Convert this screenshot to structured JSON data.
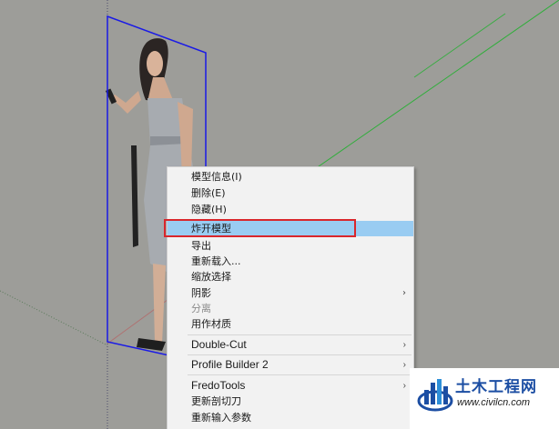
{
  "context_menu": {
    "items": [
      {
        "label": "模型信息(I)",
        "disabled": false
      },
      {
        "label": "删除(E)",
        "disabled": false
      },
      {
        "label": "隐藏(H)",
        "disabled": false
      },
      {
        "label": "炸开模型",
        "disabled": false,
        "highlighted": true
      },
      {
        "label": "导出",
        "disabled": false
      },
      {
        "label": "重新载入...",
        "disabled": false
      },
      {
        "label": "缩放选择",
        "disabled": false
      },
      {
        "label": "阴影",
        "disabled": false,
        "submenu": true
      },
      {
        "label": "分离",
        "disabled": true
      },
      {
        "label": "用作材质",
        "disabled": false
      },
      {
        "label": "Double-Cut",
        "submenu": true
      },
      {
        "label": "Profile Builder 2",
        "submenu": true
      },
      {
        "label": "FredoTools",
        "submenu": true
      },
      {
        "label": "更新剖切刀",
        "disabled": false
      },
      {
        "label": "重新输入参数",
        "disabled": false
      }
    ],
    "submenu_glyph": "›"
  },
  "watermark": {
    "title": "土木工程网",
    "url": "www.civilcn.com"
  },
  "colors": {
    "viewport_bg": "#9d9d99",
    "selection_box": "#1a1ae6",
    "green_axis": "#2fae3a",
    "menu_highlight": "#99ccf2",
    "red_box": "#d9262c",
    "logo_blue": "#1c4ea3"
  }
}
